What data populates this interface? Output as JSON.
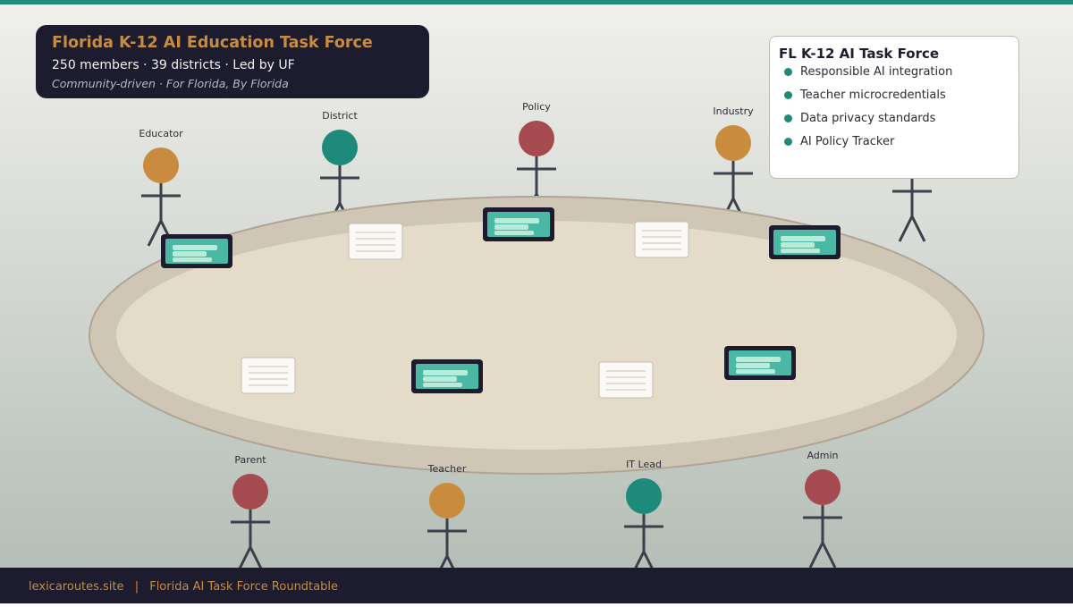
{
  "header": {
    "title": "Florida K-12 AI Education Task Force",
    "stats": "250 members · 39 districts · Led by UF",
    "tagline": "Community-driven · For Florida, By Florida"
  },
  "legend": {
    "title": "FL K-12 AI Task Force",
    "items": [
      "Responsible AI integration",
      "Teacher microcredentials",
      "Data privacy standards",
      "AI Policy Tracker"
    ]
  },
  "people": [
    {
      "role": "Educator",
      "color": "#c98c3f"
    },
    {
      "role": "District",
      "color": "#1e8a7a"
    },
    {
      "role": "Policy",
      "color": "#a54a4f"
    },
    {
      "role": "Industry",
      "color": "#c98c3f"
    },
    {
      "role": "",
      "color": "#a54a4f"
    },
    {
      "role": "Parent",
      "color": "#a54a4f"
    },
    {
      "role": "Teacher",
      "color": "#c98c3f"
    },
    {
      "role": "IT Lead",
      "color": "#1e8a7a"
    },
    {
      "role": "Admin",
      "color": "#a54a4f"
    }
  ],
  "footer": {
    "site": "lexicaroutes.site",
    "separator": "|",
    "caption": "Florida AI Task Force Roundtable"
  },
  "colors": {
    "top_bar": "#1e8a7a",
    "navy": "#1c1c2e",
    "amber": "#c98c3f",
    "teal": "#1e8a7a",
    "rose": "#a54a4f",
    "screen": "#4ab8a4",
    "screen_line": "#b6ecd9",
    "table_rim": "#d0c6b6",
    "table_top": "#e4dbc9"
  }
}
